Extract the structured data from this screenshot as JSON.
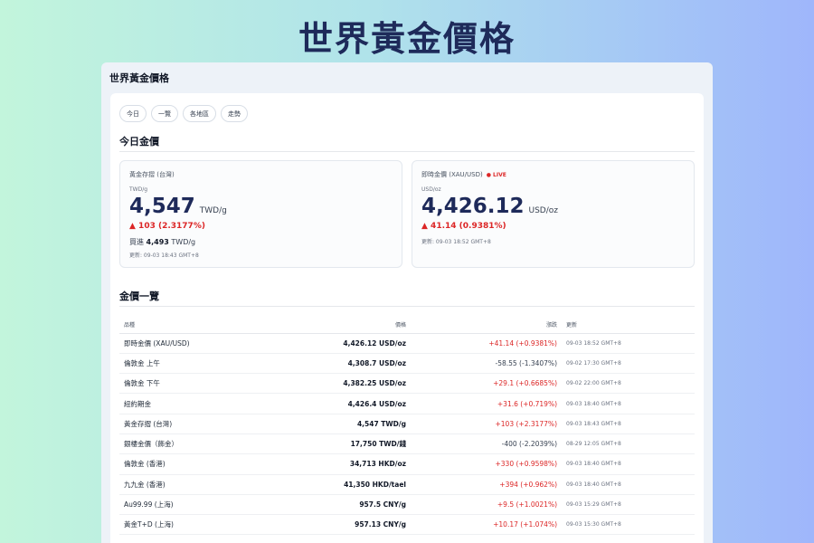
{
  "hero_title": "世界黃金價格",
  "window_title": "世界黃金價格",
  "tabs": [
    {
      "label": "今日"
    },
    {
      "label": "一覽"
    },
    {
      "label": "各地區"
    },
    {
      "label": "走勢"
    }
  ],
  "today_section": {
    "title": "今日金價",
    "cards": [
      {
        "label": "黃金存摺 (台灣)",
        "unit_small": "TWD/g",
        "price": "4,547",
        "unit": "TWD/g",
        "change": "▲ 103 (2.3177%)",
        "buy_prefix": "買進",
        "buy_value": "4,493",
        "buy_unit": "TWD/g",
        "updated": "更新: 09-03 18:43 GMT+8"
      },
      {
        "label": "即時金價 (XAU/USD)",
        "live": "● LIVE",
        "unit_small": "USD/oz",
        "price": "4,426.12",
        "unit": "USD/oz",
        "change": "▲ 41.14 (0.9381%)",
        "updated": "更新: 09-03 18:52 GMT+8"
      }
    ]
  },
  "list_section": {
    "title": "金價一覽",
    "headers": {
      "name": "品種",
      "price": "價格",
      "change": "漲跌",
      "updated": "更新"
    },
    "rows": [
      {
        "name": "即時金價 (XAU/USD)",
        "price": "4,426.12 USD/oz",
        "change": "+41.14 (+0.9381%)",
        "dir": "up",
        "updated": "09-03 18:52 GMT+8"
      },
      {
        "name": "倫敦金 上午",
        "price": "4,308.7 USD/oz",
        "change": "-58.55 (-1.3407%)",
        "dir": "down",
        "updated": "09-02 17:30 GMT+8"
      },
      {
        "name": "倫敦金 下午",
        "price": "4,382.25 USD/oz",
        "change": "+29.1 (+0.6685%)",
        "dir": "up",
        "updated": "09-02 22:00 GMT+8"
      },
      {
        "name": "紐約期金",
        "price": "4,426.4 USD/oz",
        "change": "+31.6 (+0.719%)",
        "dir": "up",
        "updated": "09-03 18:40 GMT+8"
      },
      {
        "name": "黃金存摺 (台灣)",
        "price": "4,547 TWD/g",
        "change": "+103 (+2.3177%)",
        "dir": "up",
        "updated": "09-03 18:43 GMT+8"
      },
      {
        "name": "銀樓金價（飾金）",
        "price": "17,750 TWD/錢",
        "change": "-400 (-2.2039%)",
        "dir": "down",
        "updated": "08-29 12:05 GMT+8"
      },
      {
        "name": "倫敦金 (香港)",
        "price": "34,713 HKD/oz",
        "change": "+330 (+0.9598%)",
        "dir": "up",
        "updated": "09-03 18:40 GMT+8"
      },
      {
        "name": "九九金 (香港)",
        "price": "41,350 HKD/tael",
        "change": "+394 (+0.962%)",
        "dir": "up",
        "updated": "09-03 18:40 GMT+8"
      },
      {
        "name": "Au99.99 (上海)",
        "price": "957.5 CNY/g",
        "change": "+9.5 (+1.0021%)",
        "dir": "up",
        "updated": "09-03 15:29 GMT+8"
      },
      {
        "name": "黃金T+D (上海)",
        "price": "957.13 CNY/g",
        "change": "+10.17 (+1.074%)",
        "dir": "up",
        "updated": "09-03 15:30 GMT+8"
      }
    ]
  },
  "colors": {
    "up": "#dc2626",
    "down": "#374151",
    "accent": "#1e2a5a"
  }
}
